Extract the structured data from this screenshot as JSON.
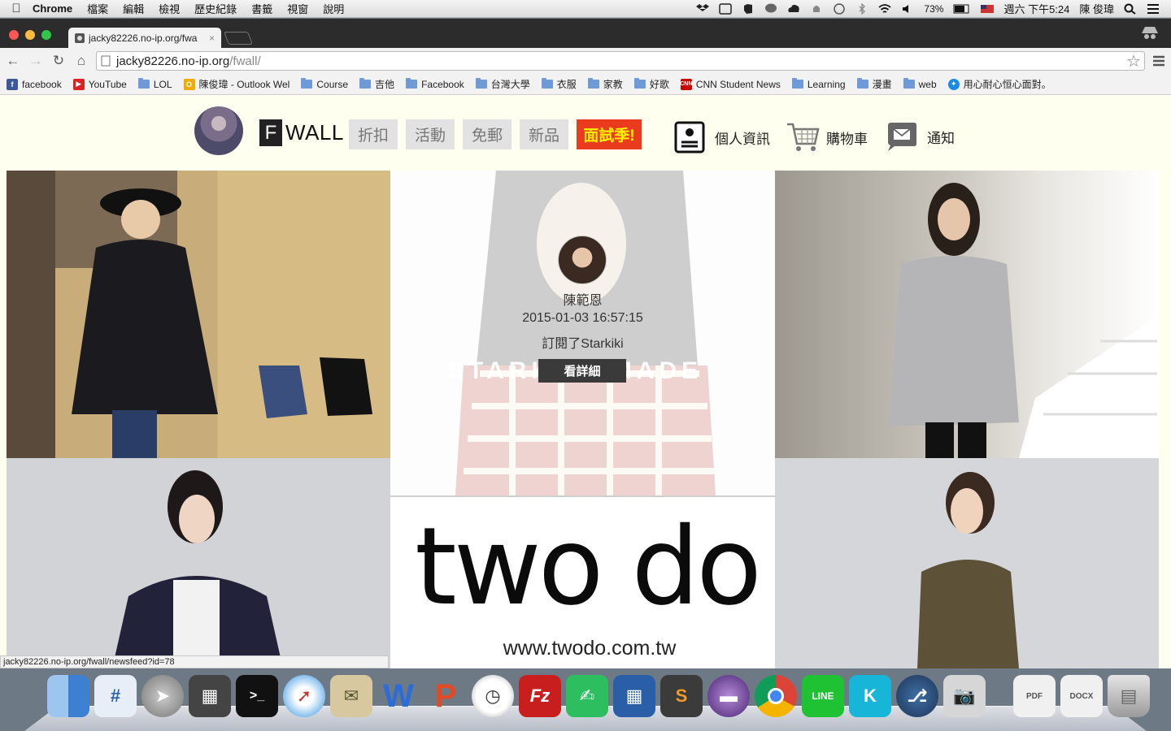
{
  "menubar": {
    "app_name": "Chrome",
    "items": [
      "檔案",
      "編輯",
      "檢視",
      "歷史紀錄",
      "書籤",
      "視窗",
      "說明"
    ],
    "battery": "73%",
    "datetime": "週六 下午5:24",
    "user": "陳 俊瑋"
  },
  "browser": {
    "tab_title": "jacky82226.no-ip.org/fwa",
    "url_host": "jacky82226.no-ip.org",
    "url_path": "/fwall/",
    "bookmarks": [
      {
        "label": "facebook",
        "icon": "facebook-icon"
      },
      {
        "label": "YouTube",
        "icon": "youtube-icon"
      },
      {
        "label": "LOL",
        "icon": "folder-icon"
      },
      {
        "label": "陳俊瑋 - Outlook Wel",
        "icon": "outlook-icon"
      },
      {
        "label": "Course",
        "icon": "folder-icon"
      },
      {
        "label": "吉他",
        "icon": "folder-icon"
      },
      {
        "label": "Facebook",
        "icon": "folder-icon"
      },
      {
        "label": "台灣大學",
        "icon": "folder-icon"
      },
      {
        "label": "衣服",
        "icon": "folder-icon"
      },
      {
        "label": "家教",
        "icon": "folder-icon"
      },
      {
        "label": "好歌",
        "icon": "folder-icon"
      },
      {
        "label": "CNN Student News",
        "icon": "cnn-icon"
      },
      {
        "label": "Learning",
        "icon": "folder-icon"
      },
      {
        "label": "漫畫",
        "icon": "folder-icon"
      },
      {
        "label": "web",
        "icon": "folder-icon"
      },
      {
        "label": "用心耐心恒心面對。",
        "icon": "star-badge-icon"
      }
    ],
    "status_url": "jacky82226.no-ip.org/fwall/newsfeed?id=78"
  },
  "site": {
    "logo_letter": "F",
    "logo_text": "WALL",
    "categories": [
      "折扣",
      "活動",
      "免郵",
      "新品"
    ],
    "hot_category": "面試季!",
    "links": {
      "profile": "個人資訊",
      "cart": "購物車",
      "notify": "通知"
    }
  },
  "feed": {
    "user_name": "陳範恩",
    "timestamp": "2015-01-03 16:57:15",
    "action": "訂閱了Starkiki",
    "brand_watermark": "STARKIKI MADE",
    "detail_button": "看詳細"
  },
  "ad": {
    "brand": "two do",
    "url": "www.twodo.com.tw"
  },
  "dock": {
    "apps": [
      "Finder",
      "Dashboard",
      "Launchpad",
      "Mission Control",
      "Terminal",
      "Safari",
      "Mail",
      "Word",
      "PowerPoint",
      "Clock",
      "FileZilla",
      "Evernote",
      "VirtualBox",
      "Sublime Text",
      "Eclipse",
      "Chrome",
      "LINE",
      "KKBOX",
      "SourceTree",
      "Preview",
      "PDF",
      "DOCX",
      "Trash"
    ]
  },
  "colors": {
    "page_bg": "#fffff0",
    "hot_bg": "#ea3b1f",
    "hot_text": "#fff200",
    "nav_box": "#e2e2e2"
  }
}
